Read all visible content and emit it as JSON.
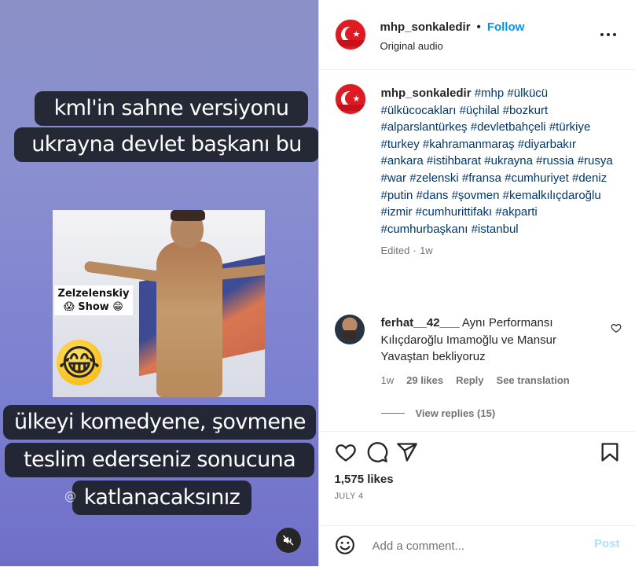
{
  "video": {
    "caption_top_line1": "kml'in sahne versiyonu",
    "caption_top_line2": "ukrayna devlet başkanı bu",
    "sticker_line1": "Zelzelenskiy",
    "sticker_line2": "😱 Show 😁",
    "sticker_emoji": "😂",
    "caption_bottom_line1": "ülkeyi komedyene, şovmene",
    "caption_bottom_line2": "teslim ederseniz sonucuna",
    "caption_bottom_line3": "katlanacaksınız",
    "watermark": "@",
    "mute_icon": "speaker-muted-icon"
  },
  "post_header": {
    "username": "mhp_sonkaledir",
    "separator": "•",
    "follow_label": "Follow",
    "audio": "Original audio",
    "more_icon": "more-horizontal-icon"
  },
  "caption": {
    "username": "mhp_sonkaledir",
    "hashtags": [
      "#mhp",
      "#ülkücü",
      "#ülkücocakları",
      "#üçhilal",
      "#bozkurt",
      "#alparslantürkeş",
      "#devletbahçeli",
      "#türkiye",
      "#turkey",
      "#kahramanmaraş",
      "#diyarbakır",
      "#ankara",
      "#istihbarat",
      "#ukrayna",
      "#russia",
      "#rusya",
      "#war",
      "#zelenski",
      "#fransa",
      "#cumhuriyet",
      "#deniz",
      "#putin",
      "#dans",
      "#şovmen",
      "#kemalkılıçdaroğlu",
      "#izmir",
      "#cumhurittifakı",
      "#akparti",
      "#cumhurbaşkanı",
      "#istanbul"
    ],
    "edited": "Edited",
    "edited_sep": "·",
    "edited_time": "1w"
  },
  "comment": {
    "username": "ferhat__42___",
    "text": "Aynı Performansı Kılıçdaroğlu Imamoğlu ve Mansur Yavaştan bekliyoruz",
    "time": "1w",
    "likes": "29 likes",
    "reply_label": "Reply",
    "translate_label": "See translation",
    "view_replies": "View replies (15)"
  },
  "actions": {
    "likes": "1,575 likes",
    "date": "JULY 4"
  },
  "add_comment": {
    "placeholder": "Add a comment...",
    "post_label": "Post"
  },
  "colors": {
    "link_blue": "#0095f6",
    "hashtag_blue": "#00376b",
    "muted_gray": "#737373",
    "post_disabled": "#b2dffc"
  }
}
